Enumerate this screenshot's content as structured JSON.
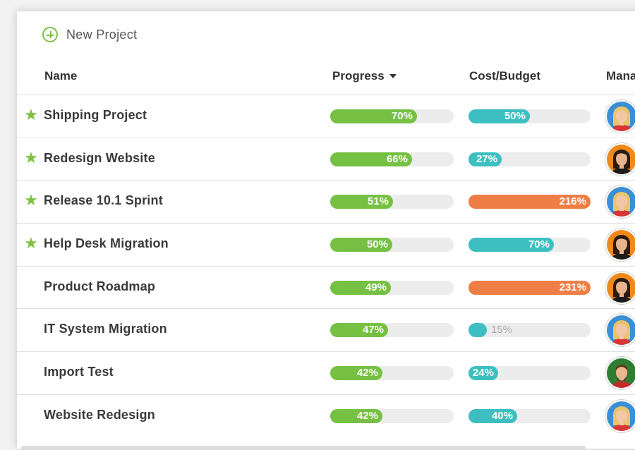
{
  "toolbar": {
    "new_project_label": "New Project"
  },
  "columns": {
    "name": "Name",
    "progress": "Progress",
    "cost": "Cost/Budget",
    "manager": "Mana"
  },
  "colors": {
    "green": "#76c043",
    "teal": "#3dbfc1",
    "orange": "#ee7d46",
    "track": "#ececec"
  },
  "rows": [
    {
      "starred": true,
      "name": "Shipping Project",
      "progress": 70,
      "progress_label": "70%",
      "cost": 50,
      "cost_label": "50%",
      "cost_color": "teal",
      "manager": "woman-blonde"
    },
    {
      "starred": true,
      "name": "Redesign Website",
      "progress": 66,
      "progress_label": "66%",
      "cost": 27,
      "cost_label": "27%",
      "cost_color": "teal",
      "manager": "woman-dark"
    },
    {
      "starred": true,
      "name": "Release 10.1 Sprint",
      "progress": 51,
      "progress_label": "51%",
      "cost": 216,
      "cost_label": "216%",
      "cost_color": "orange",
      "manager": "woman-blonde"
    },
    {
      "starred": true,
      "name": "Help Desk Migration",
      "progress": 50,
      "progress_label": "50%",
      "cost": 70,
      "cost_label": "70%",
      "cost_color": "teal",
      "manager": "woman-dark"
    },
    {
      "starred": false,
      "name": "Product Roadmap",
      "progress": 49,
      "progress_label": "49%",
      "cost": 231,
      "cost_label": "231%",
      "cost_color": "orange",
      "manager": "woman-dark"
    },
    {
      "starred": false,
      "name": "IT System Migration",
      "progress": 47,
      "progress_label": "47%",
      "cost": 15,
      "cost_label": "15%",
      "cost_color": "teal",
      "manager": "woman-blonde"
    },
    {
      "starred": false,
      "name": "Import Test",
      "progress": 42,
      "progress_label": "42%",
      "cost": 24,
      "cost_label": "24%",
      "cost_color": "teal",
      "manager": "man-beard"
    },
    {
      "starred": false,
      "name": "Website Redesign",
      "progress": 42,
      "progress_label": "42%",
      "cost": 40,
      "cost_label": "40%",
      "cost_color": "teal",
      "manager": "woman-blonde"
    }
  ]
}
